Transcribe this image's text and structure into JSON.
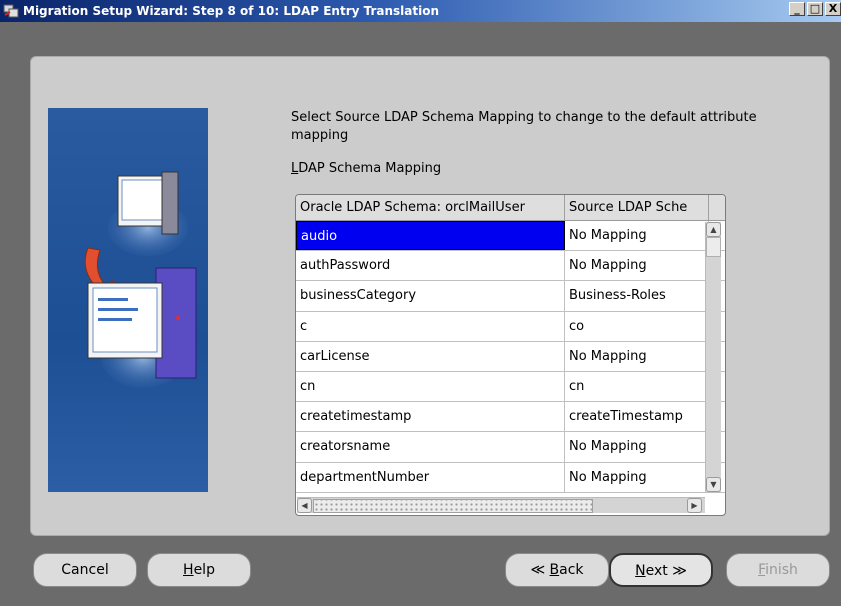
{
  "window": {
    "title": "Migration Setup Wizard:  Step 8 of 10: LDAP Entry Translation",
    "minimize": "_",
    "maximize": "□",
    "close": "X"
  },
  "instructions": {
    "prompt": "Select Source LDAP Schema Mapping to change to the default attribute mapping",
    "section_label_mnemonic": "L",
    "section_label_rest": "DAP Schema Mapping"
  },
  "table": {
    "columns": [
      "Oracle LDAP Schema: orclMailUser",
      "Source LDAP Sche"
    ],
    "rows": [
      [
        "audio",
        "No Mapping"
      ],
      [
        "authPassword",
        "No Mapping"
      ],
      [
        "businessCategory",
        "Business-Roles"
      ],
      [
        "c",
        "co"
      ],
      [
        "carLicense",
        "No Mapping"
      ],
      [
        "cn",
        "cn"
      ],
      [
        "createtimestamp",
        "createTimestamp"
      ],
      [
        "creatorsname",
        "No Mapping"
      ],
      [
        "departmentNumber",
        "No Mapping"
      ]
    ],
    "selected_row": 0
  },
  "buttons": {
    "cancel": "Cancel",
    "help_mn": "H",
    "help_rest": "elp",
    "back_arrow": "≪",
    "back_mn": "B",
    "back_rest": "ack",
    "next_mn": "N",
    "next_rest": "ext",
    "next_arrow": "≫",
    "finish_mn": "F",
    "finish_rest": "inish"
  }
}
